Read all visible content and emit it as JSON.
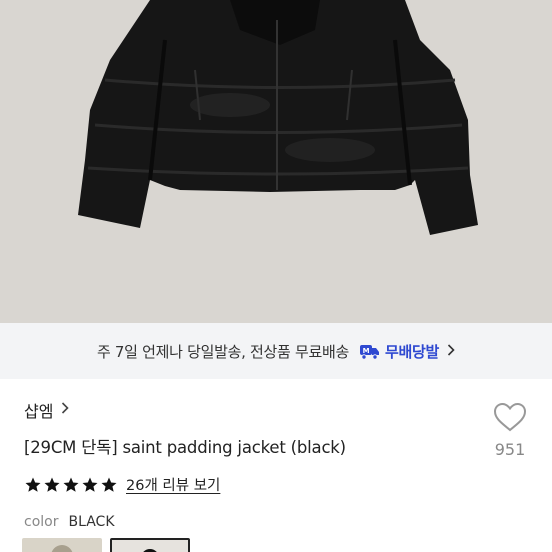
{
  "shipping": {
    "text": "주 7일 언제나 당일발송, 전상품 무료배송",
    "badge_label": "무배당발",
    "accent_color": "#2f49d1"
  },
  "product": {
    "brand": "샵엠",
    "title": "[29CM 단독] saint padding jacket (black)",
    "rating_stars": 5,
    "review_link": "26개 리뷰 보기",
    "color_label": "color",
    "color_value": "BLACK",
    "like_count": "951"
  },
  "icons": {
    "truck": "truck-icon",
    "chevron": "chevron-right-icon",
    "heart": "heart-icon",
    "star": "star-icon"
  }
}
